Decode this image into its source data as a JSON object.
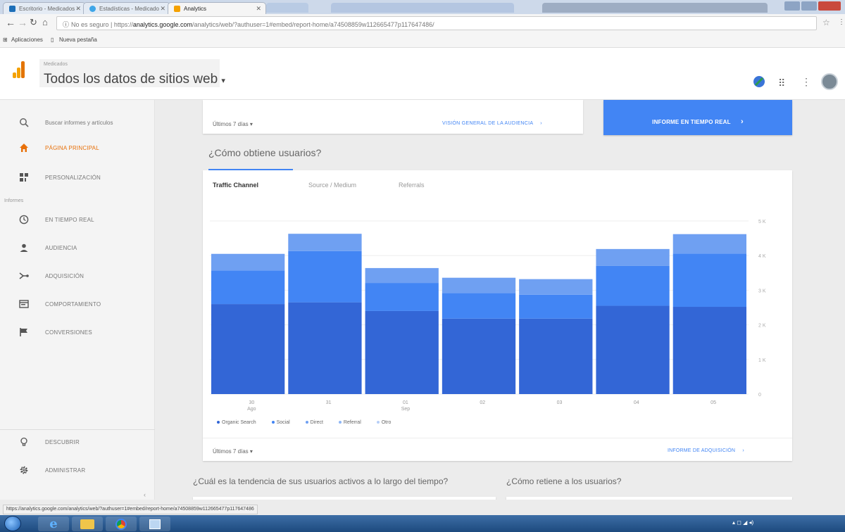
{
  "browser": {
    "tabs": [
      {
        "label": "Escritorio - Medicados -",
        "active": false
      },
      {
        "label": "Estadísticas - Medicado",
        "active": false
      },
      {
        "label": "Analytics",
        "active": true
      }
    ],
    "security_label": "No es seguro",
    "url_prefix": "https://",
    "url_host": "analytics.google.com",
    "url_path": "/analytics/web/?authuser=1#embed/report-home/a74508859w112665477p117647486/",
    "bookmarks": [
      "Aplicaciones",
      "Nueva pestaña"
    ]
  },
  "header": {
    "account_sub": "Medicados",
    "property_name": "Todos los datos de sitios web"
  },
  "sidebar": {
    "search_placeholder": "Buscar informes y artículos",
    "home": "PÁGINA PRINCIPAL",
    "customization": "PERSONALIZACIÓN",
    "reports_heading": "Informes",
    "items": [
      {
        "label": "EN TIEMPO REAL",
        "icon": "clock-icon"
      },
      {
        "label": "AUDIENCIA",
        "icon": "person-icon"
      },
      {
        "label": "ADQUISICIÓN",
        "icon": "acquisition-icon"
      },
      {
        "label": "COMPORTAMIENTO",
        "icon": "behavior-icon"
      },
      {
        "label": "CONVERSIONES",
        "icon": "flag-icon"
      }
    ],
    "discover": "DESCUBRIR",
    "admin": "ADMINISTRAR"
  },
  "main": {
    "date_range": "Últimos 7 días",
    "audience_link": "VISIÓN GENERAL DE LA AUDIENCIA",
    "realtime_button": "INFORME EN TIEMPO REAL",
    "how_title": "¿Cómo obtiene usuarios?",
    "chart_tabs": [
      "Traffic Channel",
      "Source / Medium",
      "Referrals"
    ],
    "footer_range": "Últimos 7 días",
    "acquisition_link": "INFORME DE ADQUISICIÓN",
    "trend_title": "¿Cuál es la tendencia de sus usuarios activos a lo largo del tiempo?",
    "retain_title": "¿Cómo retiene a los usuarios?"
  },
  "status_url": "https://analytics.google.com/analytics/web/?authuser=1#embed/report-home/a74508859w112665477p117647486",
  "colors": {
    "accent": "#4285f4",
    "active_nav": "#e8710a",
    "organic": "#3366d6",
    "social": "#4285f4",
    "direct": "#6fa0f2"
  },
  "chart_data": {
    "type": "bar",
    "stacked": true,
    "categories": [
      "30 Ago",
      "31",
      "01 Sep",
      "02",
      "03",
      "04",
      "05"
    ],
    "x_tick_labels": [
      [
        "30",
        "Ago"
      ],
      [
        "31"
      ],
      [
        "01",
        "Sep"
      ],
      [
        "02"
      ],
      [
        "03"
      ],
      [
        "04"
      ],
      [
        "05"
      ]
    ],
    "series": [
      {
        "name": "Organic Search",
        "color": "#3366d6",
        "values": [
          2600,
          2650,
          2400,
          2180,
          2180,
          2550,
          2520
        ]
      },
      {
        "name": "Social",
        "color": "#4285f4",
        "values": [
          970,
          1480,
          810,
          740,
          690,
          1150,
          1540
        ]
      },
      {
        "name": "Direct",
        "color": "#6fa0f2",
        "values": [
          480,
          500,
          430,
          440,
          450,
          490,
          560
        ]
      },
      {
        "name": "Referral",
        "color": "#8fb6f5",
        "values": [
          0,
          0,
          0,
          0,
          0,
          0,
          0
        ]
      },
      {
        "name": "Otro",
        "color": "#b7cff7",
        "values": [
          0,
          0,
          0,
          0,
          0,
          0,
          0
        ]
      }
    ],
    "y_ticks": [
      "0",
      "1 K",
      "2 K",
      "3 K",
      "4 K",
      "5 K"
    ],
    "ylim": [
      0,
      5000
    ],
    "grid": true,
    "legend_position": "bottom-left"
  }
}
